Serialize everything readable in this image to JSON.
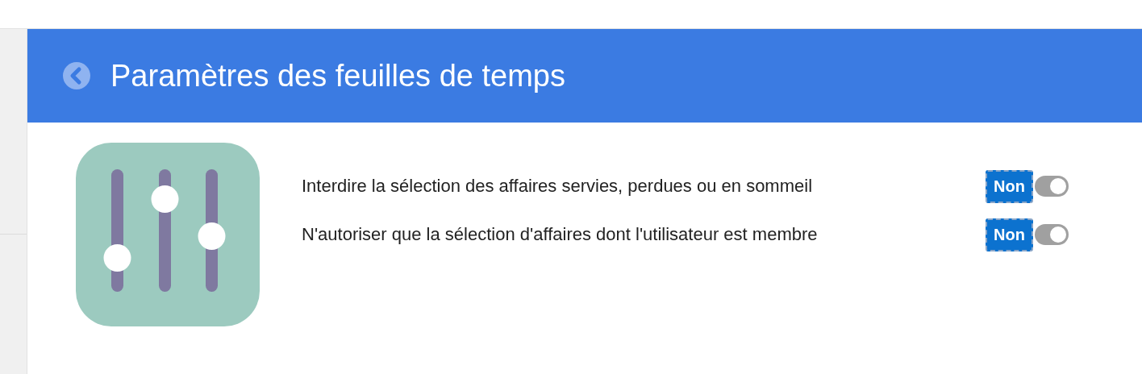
{
  "header": {
    "title": "Paramètres des feuilles de temps"
  },
  "settings": [
    {
      "label": "Interdire la sélection des affaires servies, perdues ou en sommeil",
      "value": "Non",
      "on": false
    },
    {
      "label": "N'autoriser que la sélection d'affaires dont l'utilisateur est membre",
      "value": "Non",
      "on": false
    }
  ]
}
